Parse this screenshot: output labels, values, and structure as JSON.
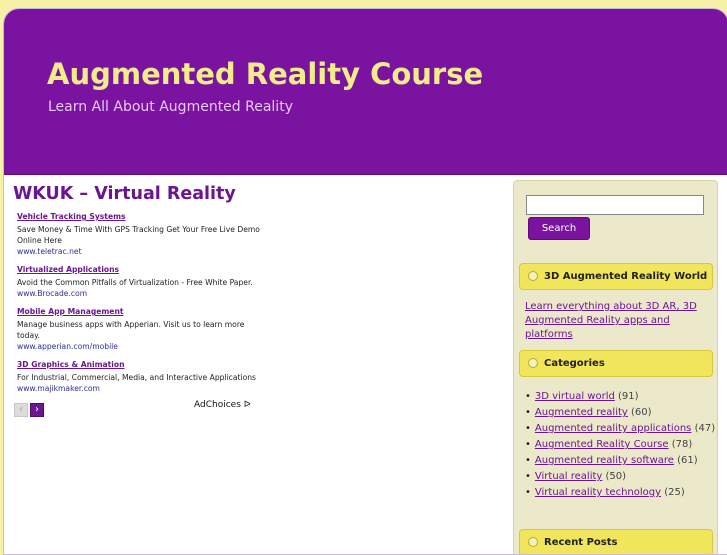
{
  "header": {
    "title": "Augmented Reality Course",
    "description": "Learn All About Augmented Reality"
  },
  "post": {
    "title": "WKUK – Virtual Reality"
  },
  "ads": [
    {
      "title": "Vehicle Tracking Systems",
      "text": "Save Money & Time With GPS Tracking Get Your Free Live Demo Online Here",
      "url": "www.teletrac.net"
    },
    {
      "title": "Virtualized Applications",
      "text": "Avoid the Common Pitfalls of Virtualization - Free White Paper.",
      "url": "www.Brocade.com"
    },
    {
      "title": "Mobile App Management",
      "text": "Manage business apps with Apperian. Visit us to learn more today.",
      "url": "www.apperian.com/mobile"
    },
    {
      "title": "3D Graphics & Animation",
      "text": "For Industrial, Commercial, Media, and Interactive Applications",
      "url": "www.majikmaker.com"
    }
  ],
  "ad_controls": {
    "prev_icon": "‹",
    "next_icon": "›",
    "adchoices_label": "AdChoices",
    "adchoices_icon": "ᐅ"
  },
  "sidebar": {
    "search": {
      "value": "",
      "button_label": "Search"
    },
    "widget_3d": {
      "title": "3D Augmented Reality World",
      "link_text": "Learn everything about 3D AR, 3D Augmented Reality apps and platforms"
    },
    "categories": {
      "title": "Categories",
      "items": [
        {
          "label": "3D virtual world",
          "count": "(91)"
        },
        {
          "label": "Augmented reality",
          "count": "(60)"
        },
        {
          "label": "Augmented reality applications",
          "count": "(47)"
        },
        {
          "label": "Augmented Reality Course",
          "count": "(78)"
        },
        {
          "label": "Augmented reality software",
          "count": "(61)"
        },
        {
          "label": "Virtual reality",
          "count": "(50)"
        },
        {
          "label": "Virtual reality technology",
          "count": "(25)"
        }
      ]
    },
    "recent_posts": {
      "title": "Recent Posts"
    }
  },
  "colors": {
    "header_bg": "#7a14a0",
    "title_yellow": "#f3ec8a",
    "link_purple": "#6a1592",
    "widget_yellow": "#f0e55b",
    "page_bg": "#f7f1a8"
  }
}
